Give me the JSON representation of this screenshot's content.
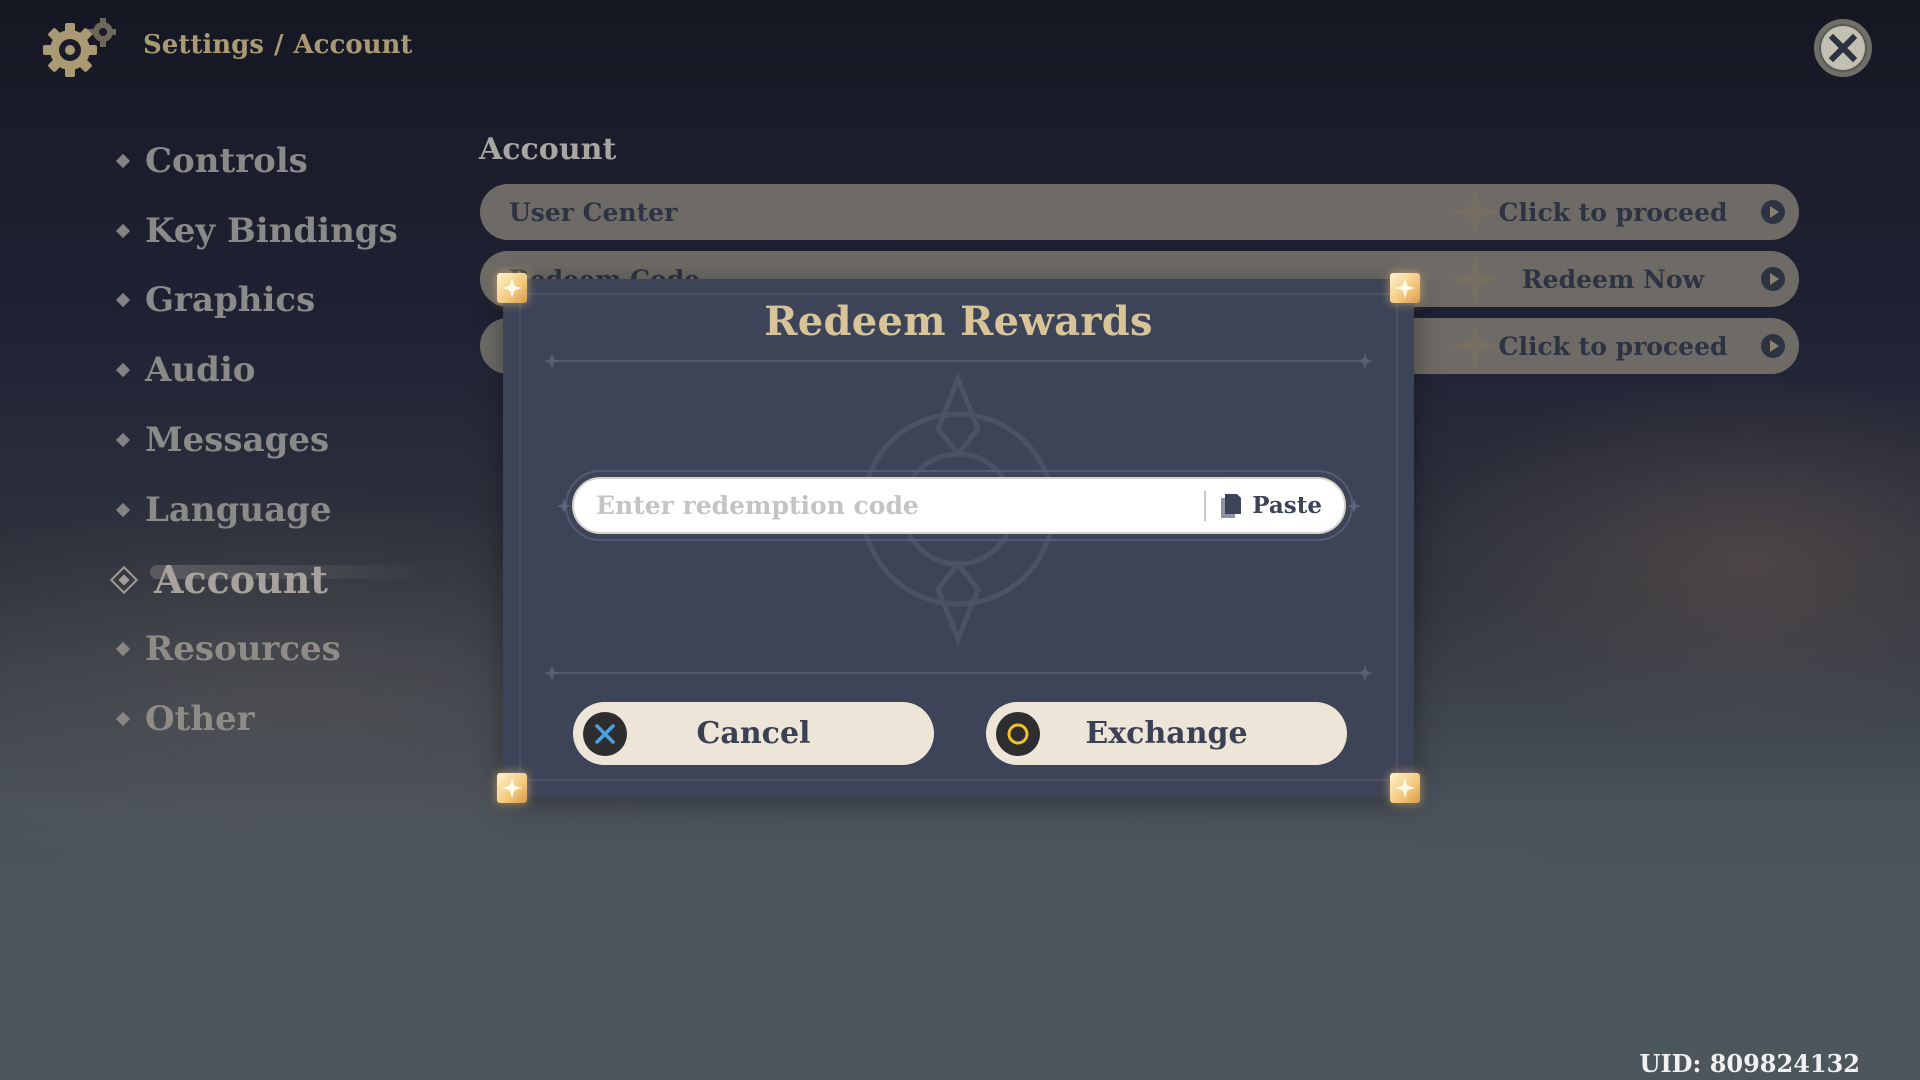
{
  "header": {
    "breadcrumb": [
      "Settings",
      "/",
      "Account"
    ],
    "icon": "gear-icon",
    "close_icon": "close-icon"
  },
  "sidebar": {
    "items": [
      {
        "label": "Controls"
      },
      {
        "label": "Key Bindings"
      },
      {
        "label": "Graphics"
      },
      {
        "label": "Audio"
      },
      {
        "label": "Messages"
      },
      {
        "label": "Language"
      },
      {
        "label": "Account",
        "active": true
      },
      {
        "label": "Resources"
      },
      {
        "label": "Other"
      }
    ]
  },
  "content": {
    "section_title": "Account",
    "rows": [
      {
        "label": "User Center",
        "action": "Click to proceed"
      },
      {
        "label": "Redeem Code",
        "action": "Redeem Now"
      },
      {
        "label": "",
        "action": "Click to proceed"
      }
    ]
  },
  "dialog": {
    "title": "Redeem Rewards",
    "input": {
      "value": "",
      "placeholder": "Enter redemption code"
    },
    "paste_label": "Paste",
    "cancel_label": "Cancel",
    "exchange_label": "Exchange"
  },
  "colors": {
    "title_gold": "#d9c49a",
    "dialog_bg": "#3d4457",
    "button_bg": "#ece5d8",
    "cancel_icon": "#4aa3e0",
    "exchange_icon": "#f0c028"
  },
  "footer": {
    "uid": "UID: 809824132"
  }
}
